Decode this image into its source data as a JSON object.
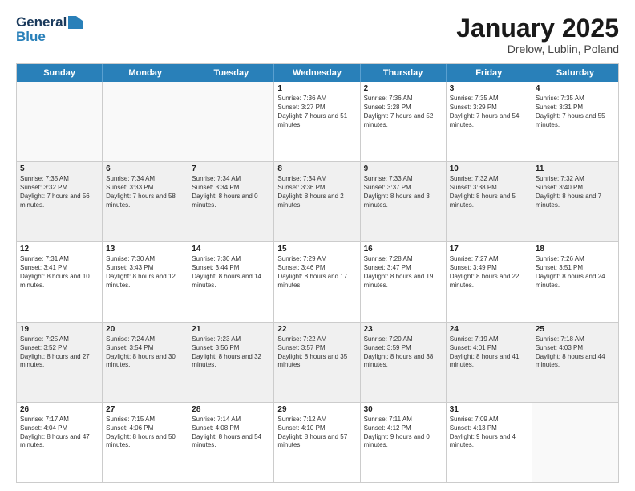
{
  "header": {
    "logo_line1": "General",
    "logo_line2": "Blue",
    "month": "January 2025",
    "location": "Drelow, Lublin, Poland"
  },
  "weekdays": [
    "Sunday",
    "Monday",
    "Tuesday",
    "Wednesday",
    "Thursday",
    "Friday",
    "Saturday"
  ],
  "weeks": [
    [
      {
        "day": "",
        "info": ""
      },
      {
        "day": "",
        "info": ""
      },
      {
        "day": "",
        "info": ""
      },
      {
        "day": "1",
        "info": "Sunrise: 7:36 AM\nSunset: 3:27 PM\nDaylight: 7 hours and 51 minutes."
      },
      {
        "day": "2",
        "info": "Sunrise: 7:36 AM\nSunset: 3:28 PM\nDaylight: 7 hours and 52 minutes."
      },
      {
        "day": "3",
        "info": "Sunrise: 7:35 AM\nSunset: 3:29 PM\nDaylight: 7 hours and 54 minutes."
      },
      {
        "day": "4",
        "info": "Sunrise: 7:35 AM\nSunset: 3:31 PM\nDaylight: 7 hours and 55 minutes."
      }
    ],
    [
      {
        "day": "5",
        "info": "Sunrise: 7:35 AM\nSunset: 3:32 PM\nDaylight: 7 hours and 56 minutes."
      },
      {
        "day": "6",
        "info": "Sunrise: 7:34 AM\nSunset: 3:33 PM\nDaylight: 7 hours and 58 minutes."
      },
      {
        "day": "7",
        "info": "Sunrise: 7:34 AM\nSunset: 3:34 PM\nDaylight: 8 hours and 0 minutes."
      },
      {
        "day": "8",
        "info": "Sunrise: 7:34 AM\nSunset: 3:36 PM\nDaylight: 8 hours and 2 minutes."
      },
      {
        "day": "9",
        "info": "Sunrise: 7:33 AM\nSunset: 3:37 PM\nDaylight: 8 hours and 3 minutes."
      },
      {
        "day": "10",
        "info": "Sunrise: 7:32 AM\nSunset: 3:38 PM\nDaylight: 8 hours and 5 minutes."
      },
      {
        "day": "11",
        "info": "Sunrise: 7:32 AM\nSunset: 3:40 PM\nDaylight: 8 hours and 7 minutes."
      }
    ],
    [
      {
        "day": "12",
        "info": "Sunrise: 7:31 AM\nSunset: 3:41 PM\nDaylight: 8 hours and 10 minutes."
      },
      {
        "day": "13",
        "info": "Sunrise: 7:30 AM\nSunset: 3:43 PM\nDaylight: 8 hours and 12 minutes."
      },
      {
        "day": "14",
        "info": "Sunrise: 7:30 AM\nSunset: 3:44 PM\nDaylight: 8 hours and 14 minutes."
      },
      {
        "day": "15",
        "info": "Sunrise: 7:29 AM\nSunset: 3:46 PM\nDaylight: 8 hours and 17 minutes."
      },
      {
        "day": "16",
        "info": "Sunrise: 7:28 AM\nSunset: 3:47 PM\nDaylight: 8 hours and 19 minutes."
      },
      {
        "day": "17",
        "info": "Sunrise: 7:27 AM\nSunset: 3:49 PM\nDaylight: 8 hours and 22 minutes."
      },
      {
        "day": "18",
        "info": "Sunrise: 7:26 AM\nSunset: 3:51 PM\nDaylight: 8 hours and 24 minutes."
      }
    ],
    [
      {
        "day": "19",
        "info": "Sunrise: 7:25 AM\nSunset: 3:52 PM\nDaylight: 8 hours and 27 minutes."
      },
      {
        "day": "20",
        "info": "Sunrise: 7:24 AM\nSunset: 3:54 PM\nDaylight: 8 hours and 30 minutes."
      },
      {
        "day": "21",
        "info": "Sunrise: 7:23 AM\nSunset: 3:56 PM\nDaylight: 8 hours and 32 minutes."
      },
      {
        "day": "22",
        "info": "Sunrise: 7:22 AM\nSunset: 3:57 PM\nDaylight: 8 hours and 35 minutes."
      },
      {
        "day": "23",
        "info": "Sunrise: 7:20 AM\nSunset: 3:59 PM\nDaylight: 8 hours and 38 minutes."
      },
      {
        "day": "24",
        "info": "Sunrise: 7:19 AM\nSunset: 4:01 PM\nDaylight: 8 hours and 41 minutes."
      },
      {
        "day": "25",
        "info": "Sunrise: 7:18 AM\nSunset: 4:03 PM\nDaylight: 8 hours and 44 minutes."
      }
    ],
    [
      {
        "day": "26",
        "info": "Sunrise: 7:17 AM\nSunset: 4:04 PM\nDaylight: 8 hours and 47 minutes."
      },
      {
        "day": "27",
        "info": "Sunrise: 7:15 AM\nSunset: 4:06 PM\nDaylight: 8 hours and 50 minutes."
      },
      {
        "day": "28",
        "info": "Sunrise: 7:14 AM\nSunset: 4:08 PM\nDaylight: 8 hours and 54 minutes."
      },
      {
        "day": "29",
        "info": "Sunrise: 7:12 AM\nSunset: 4:10 PM\nDaylight: 8 hours and 57 minutes."
      },
      {
        "day": "30",
        "info": "Sunrise: 7:11 AM\nSunset: 4:12 PM\nDaylight: 9 hours and 0 minutes."
      },
      {
        "day": "31",
        "info": "Sunrise: 7:09 AM\nSunset: 4:13 PM\nDaylight: 9 hours and 4 minutes."
      },
      {
        "day": "",
        "info": ""
      }
    ]
  ]
}
